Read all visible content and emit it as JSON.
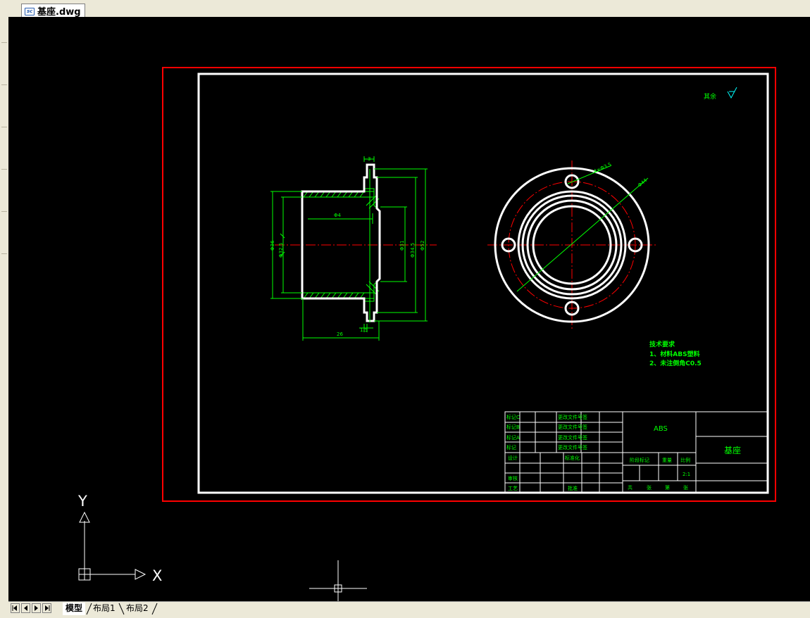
{
  "document_tab": {
    "icon": "dwg-file-icon",
    "title": "基座.dwg"
  },
  "drawing": {
    "title_block": {
      "material": "ABS",
      "part_name": "基座",
      "scale": "2:1",
      "revision_rows": [
        {
          "mark": "标记C",
          "doc": "更改文件号签"
        },
        {
          "mark": "标记B",
          "doc": "更改文件号签"
        },
        {
          "mark": "标记A",
          "doc": "更改文件号签"
        },
        {
          "mark": "标记",
          "doc": "更改文件号签"
        }
      ],
      "design": "设计",
      "standardize": "标准化",
      "review": "审核",
      "process": "工艺",
      "approve": "批准",
      "stage_mark": "阶段标记",
      "weight": "重量",
      "ratio": "比例",
      "sheet_row": [
        "共",
        "张",
        "第",
        "张"
      ]
    },
    "roughness_note": "其余",
    "tech_requirements": {
      "title": "技术要求",
      "items": [
        "1、材料ABS塑料",
        "2、未注倒角C0.5"
      ]
    },
    "dimensions": {
      "top_width": "3",
      "inner_diameter": "Φ4",
      "left_diameter": "Φ36",
      "left_diameter_inner": "Φ32.5",
      "right_inner_diameter": "Φ31",
      "right_diameter": "Φ34.5",
      "outer_diameter": "Φ52",
      "length": "26",
      "step": "1.5",
      "hole_note": "4×Φ3.5",
      "pcd": "Φ44"
    }
  },
  "layout_tabs": [
    "模型",
    "布局1",
    "布局2"
  ],
  "ucs": {
    "x_label": "X",
    "y_label": "Y"
  }
}
